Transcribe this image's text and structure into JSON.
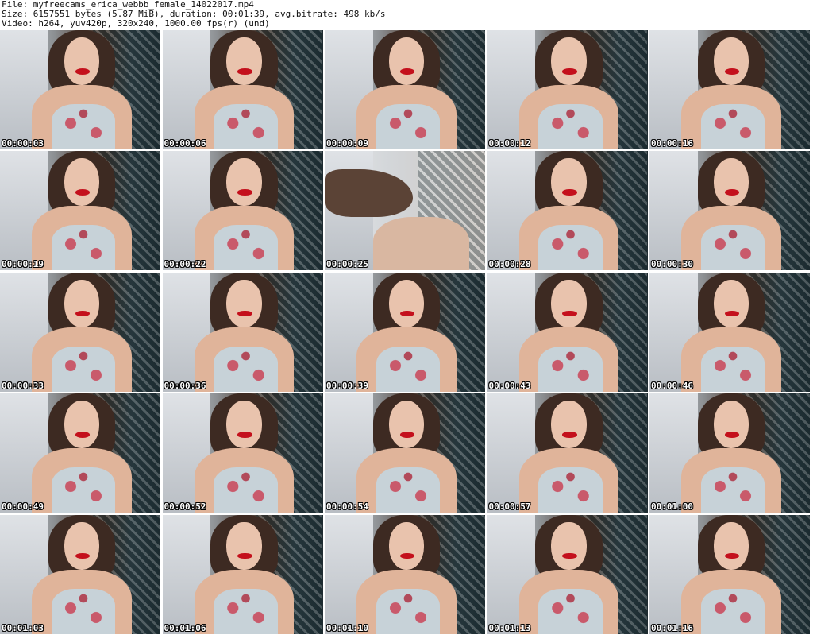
{
  "header": {
    "file": "File: myfreecams_erica_webbb_female_14022017.mp4",
    "size": "Size: 6157551 bytes (5.87 MiB), duration: 00:01:39, avg.bitrate: 498 kb/s",
    "video": "Video: h264, yuv420p, 320x240, 1000.00 fps(r) (und)"
  },
  "thumbnails": [
    {
      "time": "00:00:03"
    },
    {
      "time": "00:00:06"
    },
    {
      "time": "00:00:09"
    },
    {
      "time": "00:00:12"
    },
    {
      "time": "00:00:16"
    },
    {
      "time": "00:00:19"
    },
    {
      "time": "00:00:22"
    },
    {
      "time": "00:00:25"
    },
    {
      "time": "00:00:28"
    },
    {
      "time": "00:00:30"
    },
    {
      "time": "00:00:33"
    },
    {
      "time": "00:00:36"
    },
    {
      "time": "00:00:39"
    },
    {
      "time": "00:00:43"
    },
    {
      "time": "00:00:46"
    },
    {
      "time": "00:00:49"
    },
    {
      "time": "00:00:52"
    },
    {
      "time": "00:00:54"
    },
    {
      "time": "00:00:57"
    },
    {
      "time": "00:01:00"
    },
    {
      "time": "00:01:03"
    },
    {
      "time": "00:01:06"
    },
    {
      "time": "00:01:10"
    },
    {
      "time": "00:01:13"
    },
    {
      "time": "00:01:16"
    }
  ]
}
